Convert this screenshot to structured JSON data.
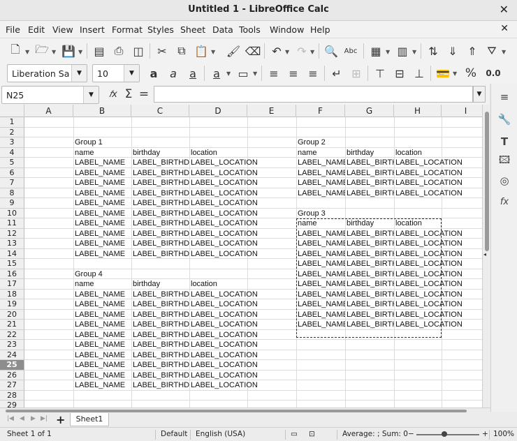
{
  "window": {
    "title": "Untitled 1 - LibreOffice Calc",
    "close_glyph": "✕"
  },
  "menu": [
    "File",
    "Edit",
    "View",
    "Insert",
    "Format",
    "Styles",
    "Sheet",
    "Data",
    "Tools",
    "Window",
    "Help"
  ],
  "formatting": {
    "font_name": "Liberation Sa",
    "font_size": "10",
    "percent": "%",
    "decimal": "0.0"
  },
  "formula_bar": {
    "name_box": "N25",
    "value": "",
    "fx_glyph": "𝑓x",
    "sum_glyph": "Σ",
    "eq_glyph": "="
  },
  "columns": [
    "A",
    "B",
    "C",
    "D",
    "E",
    "F",
    "G",
    "H",
    "I"
  ],
  "rows": [
    "1",
    "2",
    "3",
    "4",
    "5",
    "6",
    "7",
    "8",
    "9",
    "10",
    "11",
    "12",
    "13",
    "14",
    "15",
    "16",
    "17",
    "18",
    "19",
    "20",
    "21",
    "22",
    "23",
    "24",
    "25",
    "26",
    "27",
    "28",
    "29"
  ],
  "active_row": "25",
  "cells": {
    "group1_title": "Group 1",
    "group2_title": "Group 2",
    "group3_title": "Group 3",
    "group4_title": "Group 4",
    "header_name": "name",
    "header_birthday": "birthday",
    "header_location": "location",
    "label_name": "LABEL_NAME",
    "label_birthday": "LABEL_BIRTHDAY",
    "label_location": "LABEL_LOCATION"
  },
  "sheet_tab": "Sheet1",
  "status": {
    "sheet": "Sheet 1 of 1",
    "page_style": "Default",
    "language": "English (USA)",
    "summary": "Average: ; Sum: 0",
    "zoom": "100%"
  },
  "colors": {
    "active_row_header": "#8d8d8d",
    "grid_line": "#dcdcdc"
  }
}
